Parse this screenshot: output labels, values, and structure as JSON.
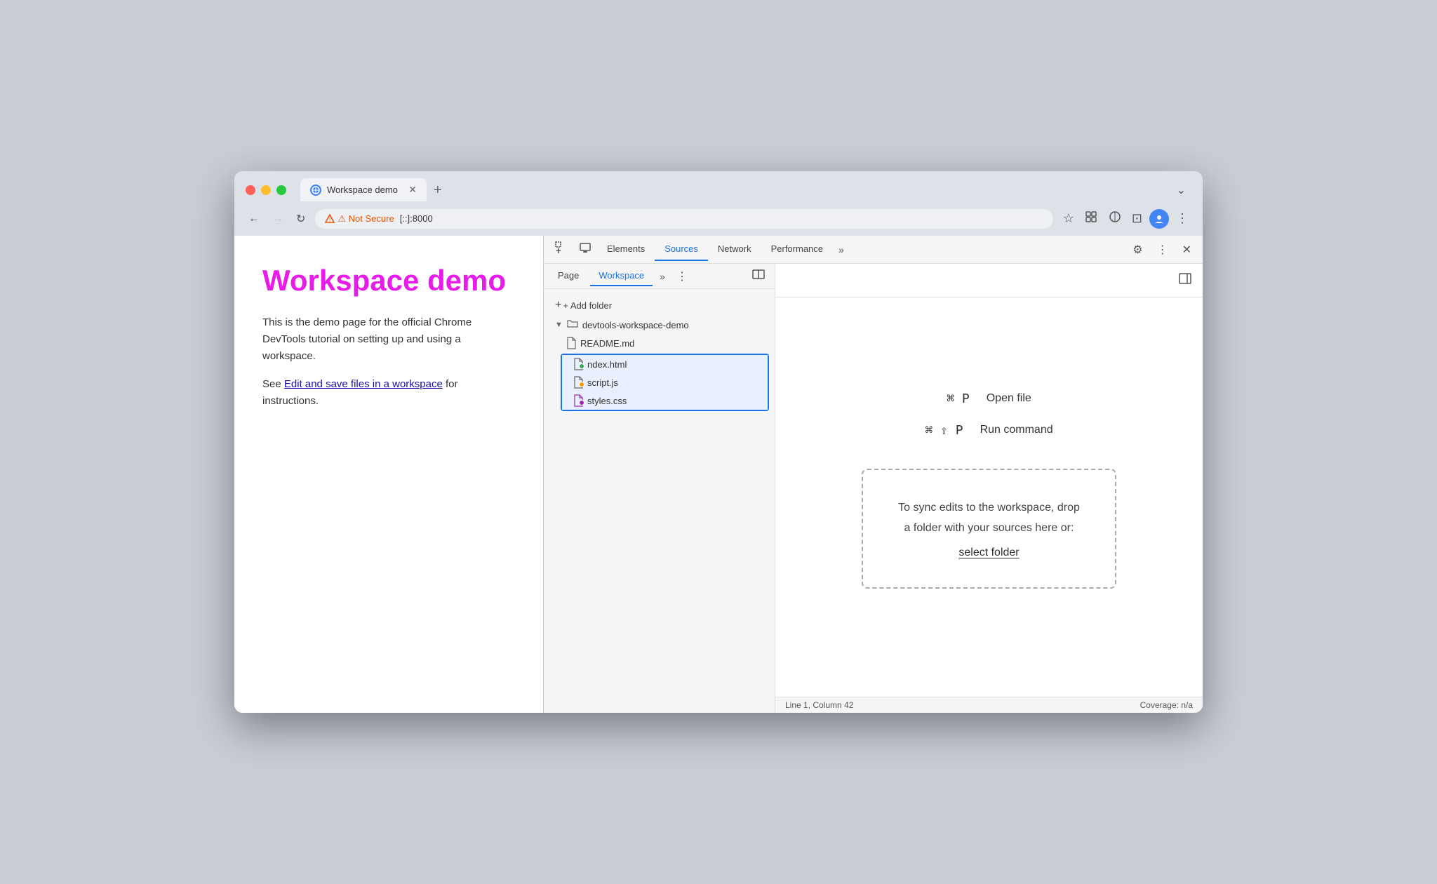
{
  "browser": {
    "tab_title": "Workspace demo",
    "tab_favicon": "🌐",
    "tab_close": "✕",
    "tab_new": "+",
    "tab_menu": "⌄",
    "nav_back": "←",
    "nav_forward": "→",
    "nav_refresh": "↻",
    "url_warning": "⚠ Not Secure",
    "url_address": "[::]:8000",
    "actions": {
      "bookmark": "☆",
      "extensions": "🧩",
      "devtools": "⚗",
      "split": "⊡",
      "profile": "👤",
      "menu": "⋮"
    }
  },
  "page": {
    "title": "Workspace demo",
    "description": "This is the demo page for the official Chrome DevTools tutorial on setting up and using a workspace.",
    "link_prefix": "See ",
    "link_text": "Edit and save files in a workspace",
    "link_suffix": " for instructions."
  },
  "devtools": {
    "tabs": [
      {
        "label": "Elements",
        "active": false
      },
      {
        "label": "Sources",
        "active": true
      },
      {
        "label": "Network",
        "active": false
      },
      {
        "label": "Performance",
        "active": false
      }
    ],
    "tabs_more": "»",
    "settings_icon": "⚙",
    "more_icon": "⋮",
    "close_icon": "✕",
    "cursor_icon": "⌖",
    "device_icon": "□"
  },
  "sources": {
    "tabs": [
      {
        "label": "Page",
        "active": false
      },
      {
        "label": "Workspace",
        "active": true
      }
    ],
    "tab_more": "»",
    "tab_menu": "⋮",
    "sidebar_toggle": "◫",
    "collapse_right": "◧",
    "add_folder_label": "+ Add folder",
    "folder_name": "devtools-workspace-demo",
    "files": [
      {
        "name": "README.md",
        "type": "readme",
        "dot": null
      },
      {
        "name": "ndex.html",
        "type": "html",
        "dot": "green"
      },
      {
        "name": "script.js",
        "type": "js",
        "dot": "orange"
      },
      {
        "name": "styles.css",
        "type": "css",
        "dot": "purple"
      }
    ],
    "shortcuts": [
      {
        "keys": "⌘ P",
        "label": "Open file"
      },
      {
        "keys": "⌘ ⇧ P",
        "label": "Run command"
      }
    ],
    "drop_zone": {
      "line1": "To sync edits to the workspace, drop",
      "line2": "a folder with your sources here or:",
      "action": "select folder"
    },
    "statusbar": {
      "position": "Line 1, Column 42",
      "coverage": "Coverage: n/a"
    }
  }
}
